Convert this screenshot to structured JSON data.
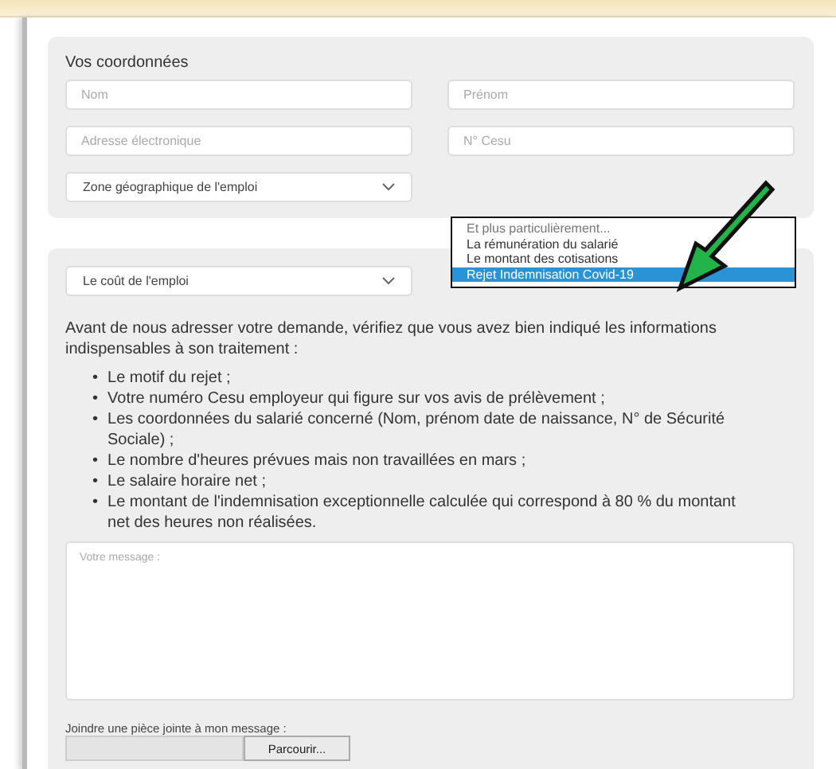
{
  "section_title": "Vos coordonnées",
  "fields": [
    {
      "placeholder": "Nom"
    },
    {
      "placeholder": "Prénom"
    },
    {
      "placeholder": "Adresse électronique"
    },
    {
      "placeholder": "N° Cesu"
    }
  ],
  "zone_select": {
    "value": "Zone géographique de l'emploi"
  },
  "topic_select": {
    "value": "Le coût de l'emploi"
  },
  "dropdown_options": [
    {
      "label": "Et plus particulièrement...",
      "selected": false,
      "disabled": true
    },
    {
      "label": "La rémunération du salarié",
      "selected": false,
      "disabled": false
    },
    {
      "label": "Le montant des cotisations",
      "selected": false,
      "disabled": false
    },
    {
      "label": "Rejet Indemnisation Covid-19",
      "selected": true,
      "disabled": false
    }
  ],
  "intro": "Avant de nous adresser votre demande, vérifiez que vous avez bien indiqué les informations indispensables à son traitement :",
  "checklist": [
    {
      "bullet": "•",
      "text": "Le motif du rejet ;"
    },
    {
      "bullet": "•",
      "text": "Votre numéro Cesu employeur qui figure sur vos avis de prélèvement ;"
    },
    {
      "bullet": "•",
      "text": "Les coordonnées du salarié concerné (Nom, prénom date de naissance, N° de Sécurité Sociale) ;"
    },
    {
      "bullet": "•",
      "text": "Le nombre d'heures prévues mais non travaillées en mars ;"
    },
    {
      "bullet": "•",
      "text": "Le salaire horaire net ;"
    },
    {
      "bullet": "•",
      "text": "Le montant de l'indemnisation exceptionnelle calculée qui correspond à 80 % du montant net des heures non réalisées."
    }
  ],
  "message": {
    "placeholder": "Votre message :"
  },
  "attachment": {
    "label": "Joindre une pièce jointe à mon message :",
    "button": "Parcourir..."
  }
}
